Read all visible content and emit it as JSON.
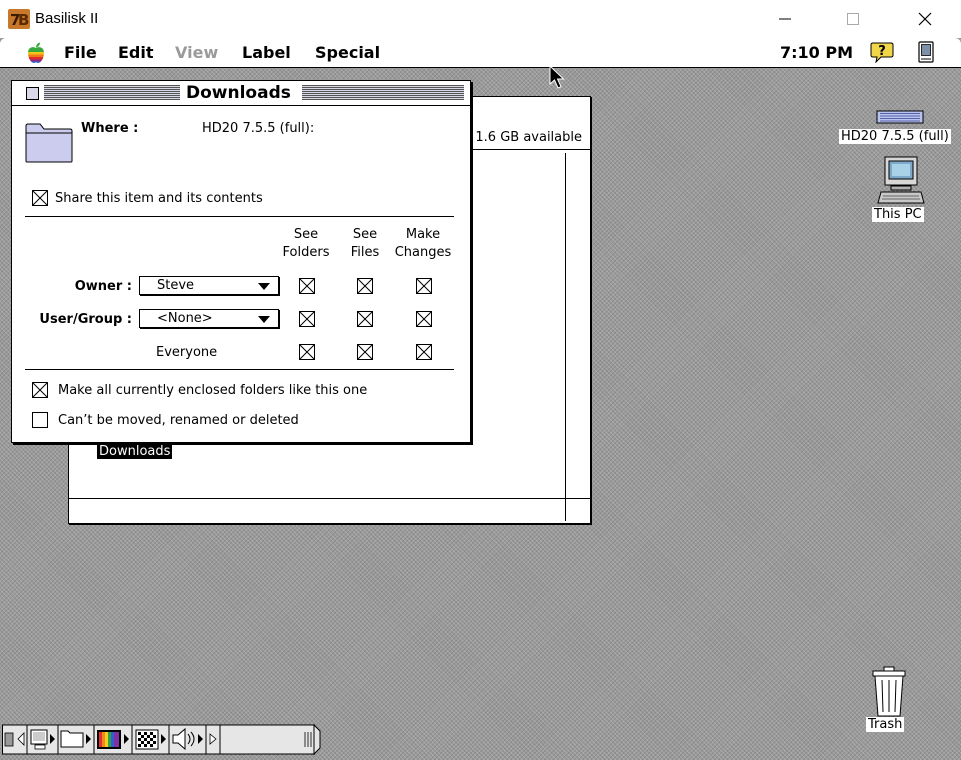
{
  "host_window": {
    "title": "Basilisk II"
  },
  "menubar": {
    "menus": {
      "file": "File",
      "edit": "Edit",
      "view": "View",
      "label": "Label",
      "special": "Special"
    },
    "clock": "7:10 PM"
  },
  "finder_window": {
    "available": "1.6 GB available",
    "selected_item": "Downloads"
  },
  "sharing_dialog": {
    "title": "Downloads",
    "where_label": "Where :",
    "where_value": "HD20 7.5.5 (full):",
    "share_checkbox": {
      "label": "Share this item and its contents",
      "checked": true
    },
    "columns": {
      "see_folders": [
        "See",
        "Folders"
      ],
      "see_files": [
        "See",
        "Files"
      ],
      "make_changes": [
        "Make",
        "Changes"
      ]
    },
    "rows": {
      "owner": {
        "label": "Owner :",
        "value": "Steve",
        "see_folders": true,
        "see_files": true,
        "make_changes": true
      },
      "user_group": {
        "label": "User/Group :",
        "value": "<None>",
        "see_folders": true,
        "see_files": true,
        "make_changes": true
      },
      "everyone": {
        "label": "Everyone",
        "see_folders": true,
        "see_files": true,
        "make_changes": true
      }
    },
    "make_all_checkbox": {
      "label": "Make all currently enclosed folders like this one",
      "checked": true
    },
    "cant_move_checkbox": {
      "label": "Can’t be moved, renamed or deleted",
      "checked": false
    }
  },
  "desktop_icons": {
    "hard_disk": "HD20 7.5.5 (full)",
    "this_pc": "This PC",
    "trash": "Trash"
  },
  "icons": {
    "apple_menu": "apple-icon",
    "help": "help-icon",
    "application": "app-menu-icon",
    "folder": "folder-icon",
    "hard_disk": "hard-disk-icon",
    "computer": "computer-icon",
    "trash": "trash-icon"
  }
}
